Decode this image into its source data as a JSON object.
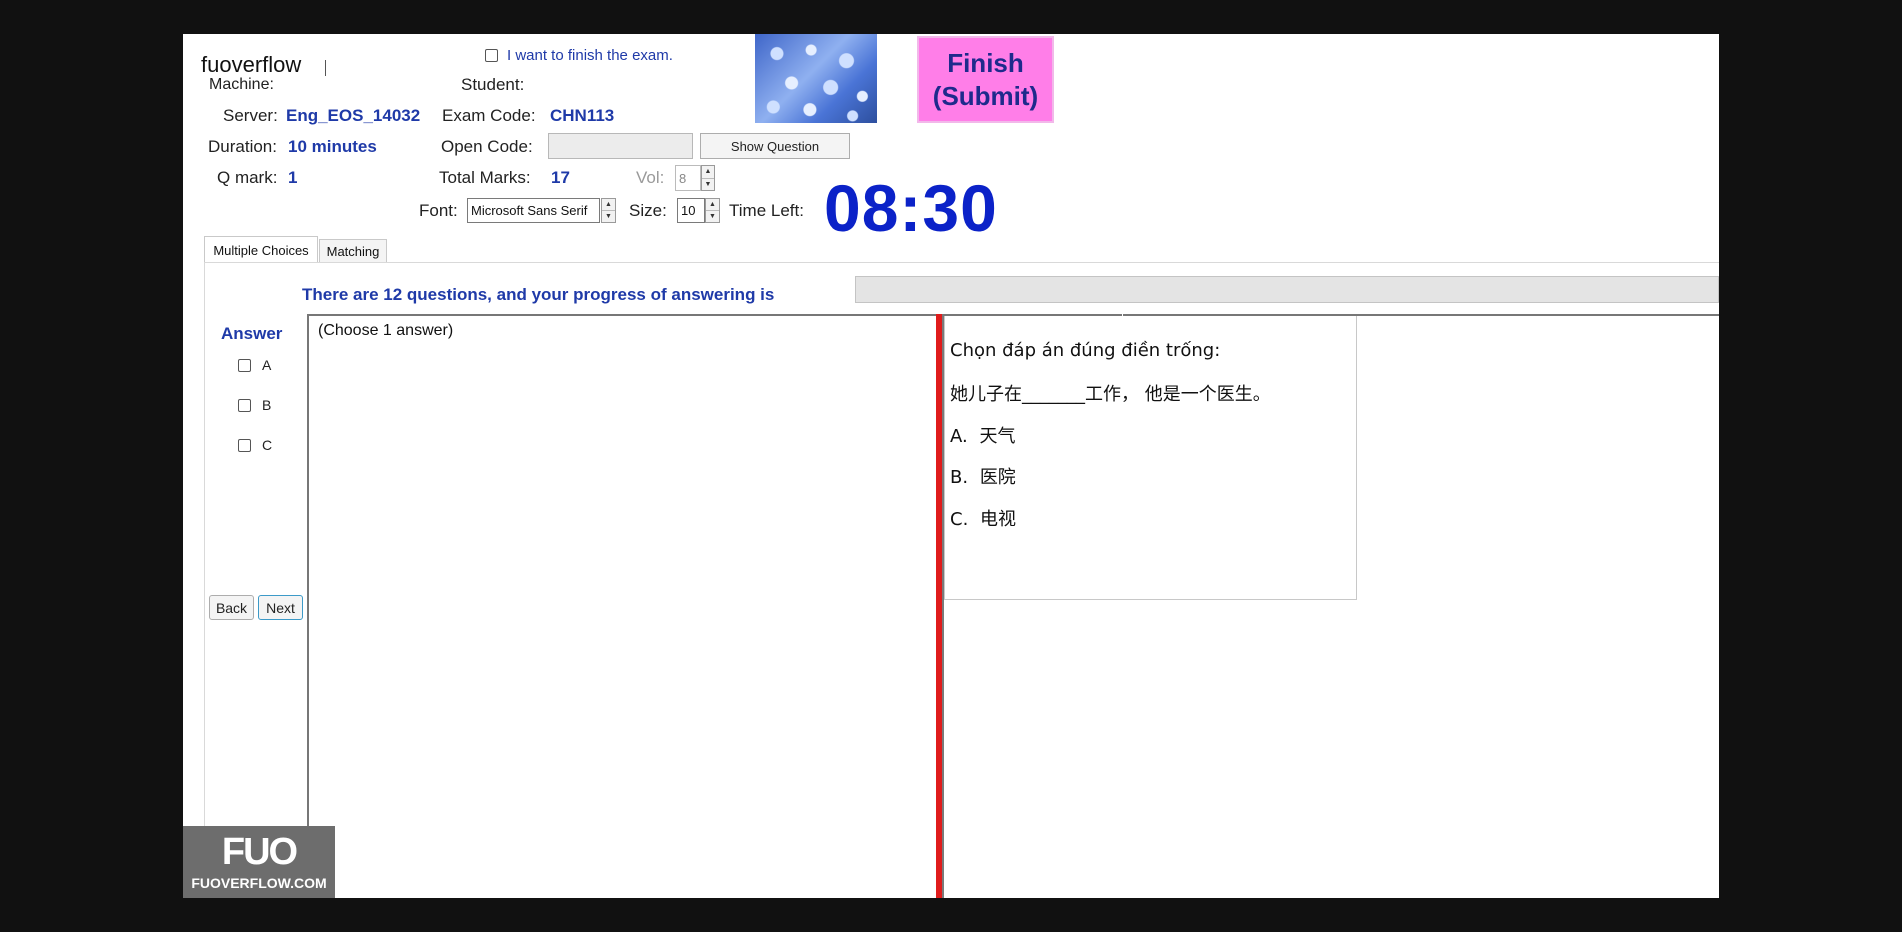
{
  "app": {
    "brand": "fuoverflow"
  },
  "header": {
    "finish_exam_checkbox_label": "I want to finish the exam.",
    "machine_label": "Machine:",
    "student_label": "Student:",
    "server_label": "Server:",
    "server_value": "Eng_EOS_14032",
    "exam_code_label": "Exam Code:",
    "exam_code_value": "CHN113",
    "duration_label": "Duration:",
    "duration_value": "10 minutes",
    "open_code_label": "Open Code:",
    "open_code_value": "",
    "show_question_button": "Show Question",
    "q_mark_label": "Q mark:",
    "q_mark_value": "1",
    "total_marks_label": "Total Marks:",
    "total_marks_value": "17",
    "vol_label": "Vol:",
    "vol_value": "8",
    "font_label": "Font:",
    "font_value": "Microsoft Sans Serif",
    "size_label": "Size:",
    "size_value": "10",
    "time_left_label": "Time Left:",
    "time_left_value": "08:30",
    "finish_button_line1": "Finish",
    "finish_button_line2": "(Submit)"
  },
  "tabs": [
    {
      "label": "Multiple Choices",
      "active": true
    },
    {
      "label": "Matching",
      "active": false
    }
  ],
  "progress": {
    "message": "There are 12 questions, and your progress of answering is",
    "fraction": 0
  },
  "answer": {
    "heading": "Answer",
    "options": [
      {
        "label": "A",
        "checked": false
      },
      {
        "label": "B",
        "checked": false
      },
      {
        "label": "C",
        "checked": false
      }
    ],
    "back_button": "Back",
    "next_button": "Next"
  },
  "question": {
    "choose_hint": "(Choose 1 answer)",
    "instruction": "Chọn đáp án đúng điền trống:",
    "sentence": "她儿子在_______工作， 他是一个医生。",
    "choices": [
      {
        "letter": "A.",
        "text": "天气"
      },
      {
        "letter": "B.",
        "text": "医院"
      },
      {
        "letter": "C.",
        "text": "电视"
      }
    ]
  },
  "watermark": {
    "logo": "FUO",
    "text": "FUOVERFLOW.COM"
  },
  "colors": {
    "label_blue": "#1f3aa8",
    "timer_blue": "#0b22c8",
    "finish_pink": "#ff7ee8",
    "splitter_red": "#e01c1c"
  }
}
